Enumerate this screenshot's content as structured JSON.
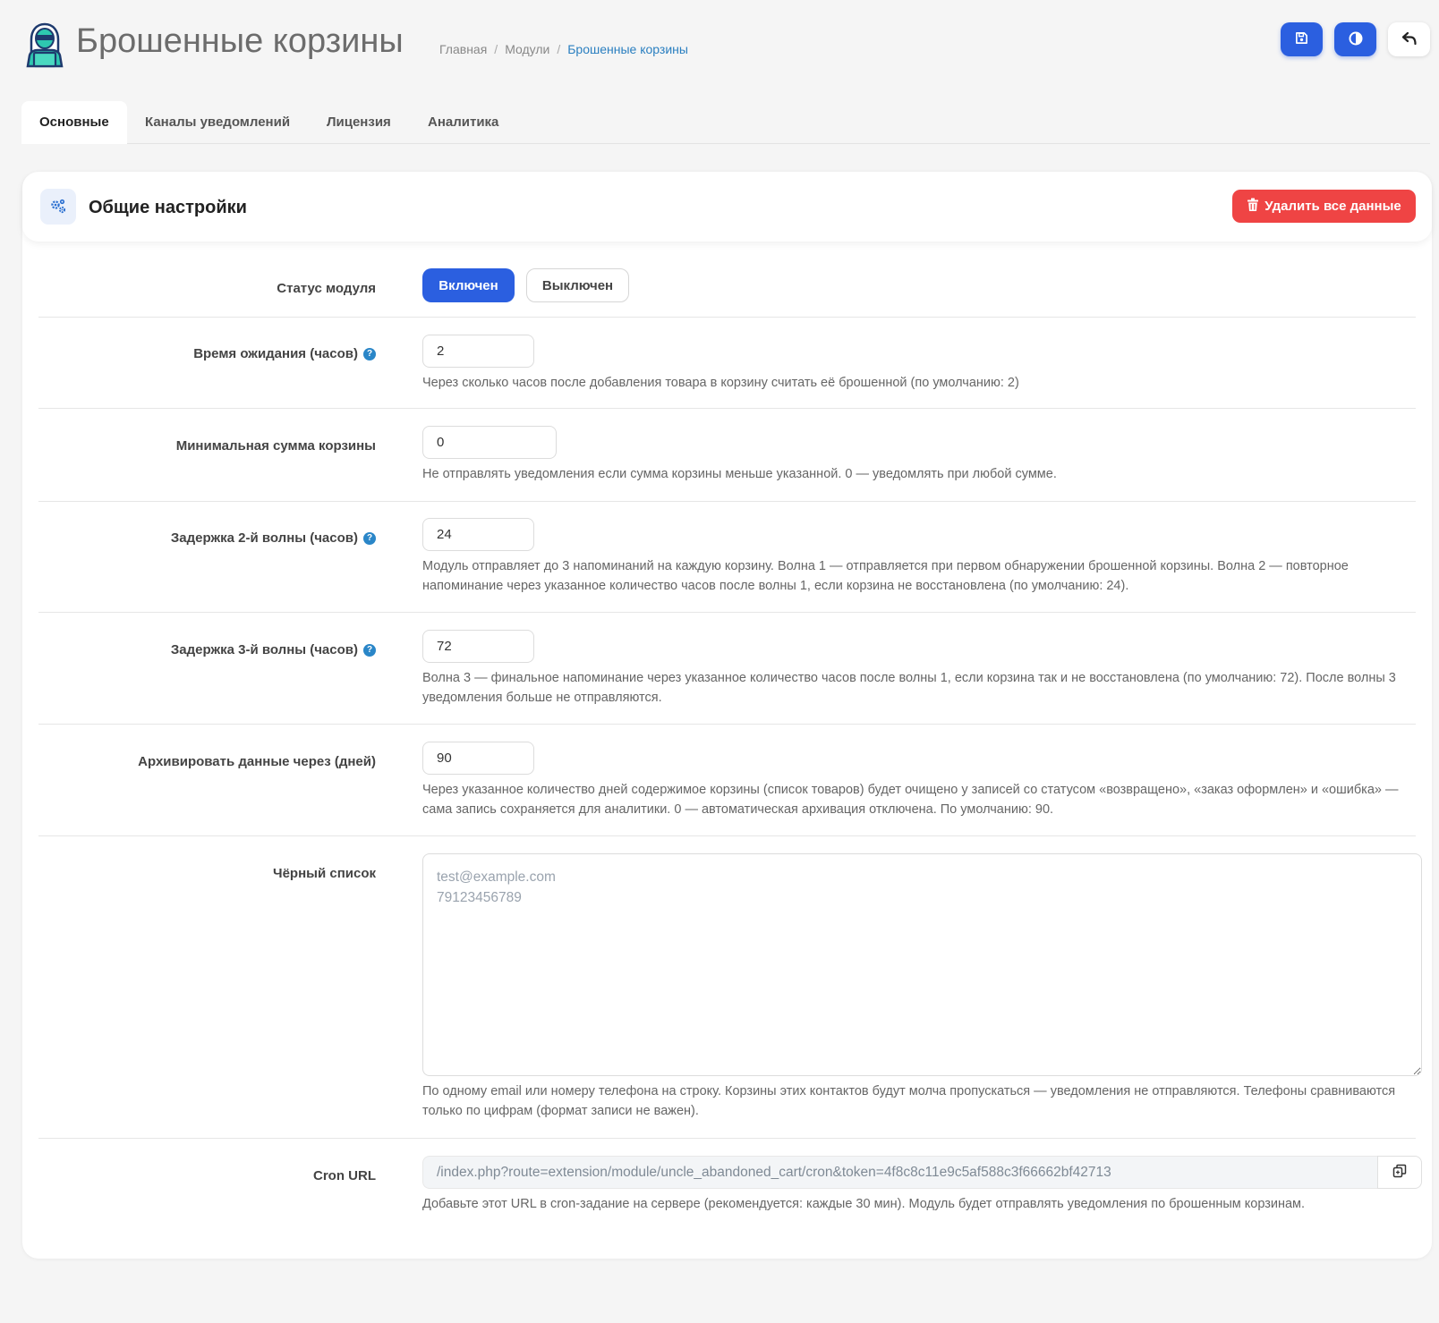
{
  "header": {
    "title": "Брошенные корзины",
    "breadcrumb": [
      "Главная",
      "Модули",
      "Брошенные корзины"
    ],
    "actions": [
      {
        "icon": "save-icon"
      },
      {
        "icon": "contrast-icon"
      },
      {
        "icon": "back-arrow-icon"
      }
    ],
    "colors": {
      "primary": "#2b5fe0",
      "danger": "#ef4444"
    }
  },
  "tabs": [
    {
      "label": "Основные",
      "active": true
    },
    {
      "label": "Каналы уведомлений"
    },
    {
      "label": "Лицензия"
    },
    {
      "label": "Аналитика"
    }
  ],
  "card": {
    "title": "Общие настройки",
    "delete_label": "Удалить все данные"
  },
  "fields": {
    "status": {
      "label": "Статус модуля",
      "on": "Включен",
      "off": "Выключен",
      "selected": "Включен"
    },
    "wait_time": {
      "label": "Время ожидания (часов)",
      "value": "2",
      "hint": "Через сколько часов после добавления товара в корзину считать её брошенной (по умолчанию: 2)"
    },
    "min_sum": {
      "label": "Минимальная сумма корзины",
      "value": "0",
      "hint": "Не отправлять уведомления если сумма корзины меньше указанной. 0 — уведомлять при любой сумме."
    },
    "wave2": {
      "label": "Задержка 2-й волны (часов)",
      "value": "24",
      "hint": "Модуль отправляет до 3 напоминаний на каждую корзину. Волна 1 — отправляется при первом обнаружении брошенной корзины. Волна 2 — повторное напоминание через указанное количество часов после волны 1, если корзина не восстановлена (по умолчанию: 24)."
    },
    "wave3": {
      "label": "Задержка 3-й волны (часов)",
      "value": "72",
      "hint": "Волна 3 — финальное напоминание через указанное количество часов после волны 1, если корзина так и не восстановлена (по умолчанию: 72). После волны 3 уведомления больше не отправляются."
    },
    "archive": {
      "label": "Архивировать данные через (дней)",
      "value": "90",
      "hint": "Через указанное количество дней содержимое корзины (список товаров) будет очищено у записей со статусом «возвращено», «заказ оформлен» и «ошибка» — сама запись сохраняется для аналитики. 0 — автоматическая архивация отключена. По умолчанию: 90."
    },
    "blacklist": {
      "label": "Чёрный список",
      "placeholder": "test@example.com\n79123456789",
      "hint": "По одному email или номеру телефона на строку. Корзины этих контактов будут молча пропускаться — уведомления не отправляются. Телефоны сравниваются только по цифрам (формат записи не важен)."
    },
    "cron": {
      "label": "Cron URL",
      "value": "/index.php?route=extension/module/uncle_abandoned_cart/cron&token=4f8c8c11e9c5af588c3f66662bf42713",
      "hint": "Добавьте этот URL в cron-задание на сервере (рекомендуется: каждые 30 мин). Модуль будет отправлять уведомления по брошенным корзинам."
    }
  }
}
